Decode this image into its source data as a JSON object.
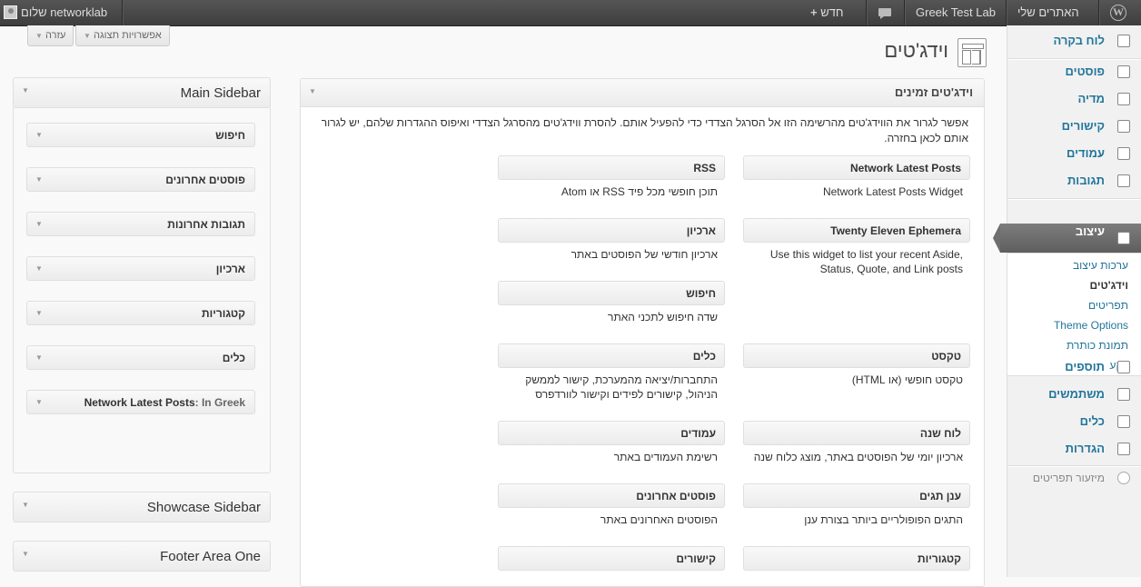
{
  "admin_bar": {
    "howdy": "שלום networklab",
    "new": "חדש",
    "site_name": "Greek Test Lab",
    "my_sites": "האתרים שלי"
  },
  "screen_tabs": {
    "help": "עזרה",
    "screen_options": "אפשרויות תצוגה"
  },
  "page_title": "וידג'טים",
  "menu": {
    "dashboard": "לוח בקרה",
    "posts": "פוסטים",
    "media": "מדיה",
    "links": "קישורים",
    "pages": "עמודים",
    "comments": "תגובות",
    "appearance": "עיצוב",
    "appearance_sub": [
      "ערכות עיצוב",
      "וידג'טים",
      "תפריטים",
      "Theme Options",
      "תמונת כותרת",
      "רקע"
    ],
    "plugins": "תוספים",
    "users": "משתמשים",
    "tools": "כלים",
    "settings": "הגדרות",
    "collapse": "מיזעור תפריטים"
  },
  "available": {
    "title": "וידג'טים זמינים",
    "description": "אפשר לגרור את הווידג'טים מהרשימה הזו אל הסרגל הצדדי כדי להפעיל אותם. להסרת ווידג'טים מהסרגל הצדדי ואיפוס ההגדרות שלהם, יש לגרור אותם לכאן בחזרה.",
    "widgets": [
      {
        "title": "Network Latest Posts",
        "desc": "Network Latest Posts Widget"
      },
      {
        "title": "RSS",
        "desc": "תוכן חופשי מכל פיד RSS או Atom"
      },
      {
        "title": "Twenty Eleven Ephemera",
        "desc": "Use this widget to list your recent Aside, Status, Quote, and Link posts"
      },
      {
        "title": "ארכיון",
        "desc": "ארכיון חודשי של הפוסטים באתר"
      },
      {
        "title": "חיפוש",
        "desc": "שדה חיפוש לתכני האתר"
      },
      {
        "title": "טקסט",
        "desc": "טקסט חופשי (או HTML)"
      },
      {
        "title": "כלים",
        "desc": "התחברות/יציאה מהמערכת, קישור לממשק הניהול, קישורים לפידים וקישור לוורדפרס"
      },
      {
        "title": "לוח שנה",
        "desc": "ארכיון יומי של הפוסטים באתר, מוצג כלוח שנה"
      },
      {
        "title": "עמודים",
        "desc": "רשימת העמודים באתר"
      },
      {
        "title": "ענן תגים",
        "desc": "התגים הפופולריים ביותר בצורת ענן"
      },
      {
        "title": "פוסטים אחרונים",
        "desc": "הפוסטים האחרונים באתר"
      },
      {
        "title": "קטגוריות",
        "desc": ""
      },
      {
        "title": "קישורים",
        "desc": ""
      }
    ]
  },
  "sidebars": {
    "main": {
      "title": "Main Sidebar",
      "widgets": [
        "חיפוש",
        "פוסטים אחרונים",
        "תגובות אחרונות",
        "ארכיון",
        "קטגוריות",
        "כלים"
      ],
      "network_widget": "Network Latest Posts",
      "network_widget_sub": ": In Greek"
    },
    "showcase": "Showcase Sidebar",
    "footer_one": "Footer Area One"
  }
}
